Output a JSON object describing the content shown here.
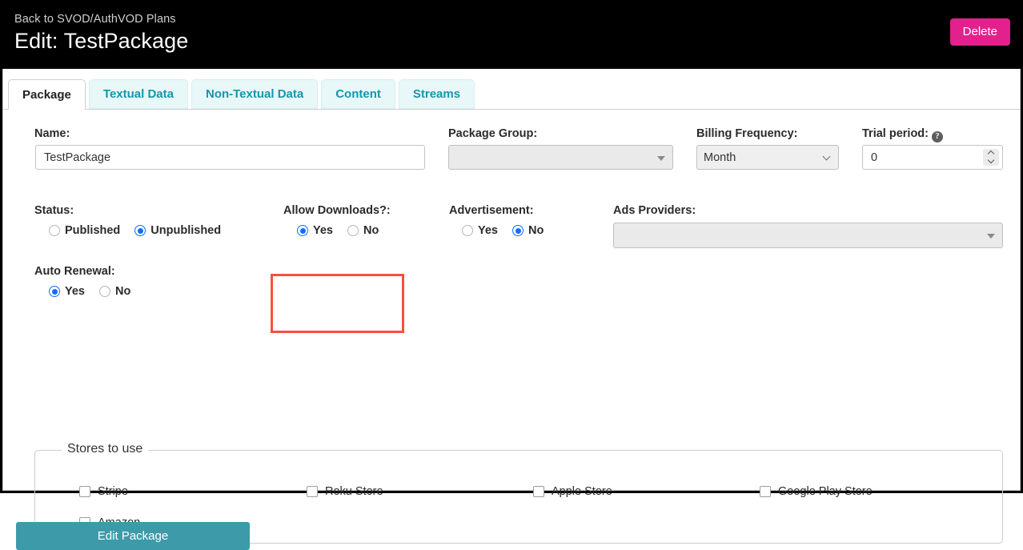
{
  "header": {
    "back_link": "Back to SVOD/AuthVOD Plans",
    "title": "Edit: TestPackage",
    "delete_label": "Delete",
    "delete_color": "#e2218c",
    "background": "#000000"
  },
  "tabs": [
    {
      "label": "Package",
      "active": true
    },
    {
      "label": "Textual Data",
      "active": false
    },
    {
      "label": "Non-Textual Data",
      "active": false
    },
    {
      "label": "Content",
      "active": false
    },
    {
      "label": "Streams",
      "active": false
    }
  ],
  "tab_colors": {
    "inactive_bg": "#e8f7f8",
    "inactive_text": "#1596ad",
    "active_text": "#222222"
  },
  "form": {
    "name": {
      "label": "Name:",
      "value": "TestPackage",
      "placeholder": ""
    },
    "package_group": {
      "label": "Package Group:",
      "value": "",
      "caret": "caret-down-icon"
    },
    "billing_frequency": {
      "label": "Billing Frequency:",
      "value": "Month",
      "options": [
        "Month"
      ]
    },
    "trial_period": {
      "label": "Trial period:",
      "help": "?",
      "value": "0"
    },
    "status": {
      "label": "Status:",
      "options": [
        {
          "label": "Published",
          "checked": false
        },
        {
          "label": "Unpublished",
          "checked": true
        }
      ]
    },
    "allow_downloads": {
      "label": "Allow Downloads?:",
      "highlighted": true,
      "highlight_color": "#f4513c",
      "options": [
        {
          "label": "Yes",
          "checked": true
        },
        {
          "label": "No",
          "checked": false
        }
      ]
    },
    "advertisement": {
      "label": "Advertisement:",
      "options": [
        {
          "label": "Yes",
          "checked": false
        },
        {
          "label": "No",
          "checked": true
        }
      ]
    },
    "ads_providers": {
      "label": "Ads Providers:",
      "value": "",
      "caret": "caret-down-icon"
    },
    "auto_renewal": {
      "label": "Auto Renewal:",
      "options": [
        {
          "label": "Yes",
          "checked": true
        },
        {
          "label": "No",
          "checked": false
        }
      ]
    },
    "stores": {
      "legend": "Stores to use",
      "items": [
        {
          "label": "Stripe",
          "checked": false
        },
        {
          "label": "Roku Store",
          "checked": false
        },
        {
          "label": "Apple Store",
          "checked": false
        },
        {
          "label": "Google Play Store",
          "checked": false
        },
        {
          "label": "Amazon",
          "checked": false
        }
      ]
    },
    "submit": {
      "label": "Edit Package",
      "color": "#3d9aa8"
    }
  },
  "radio_accent": "#0d6efd"
}
